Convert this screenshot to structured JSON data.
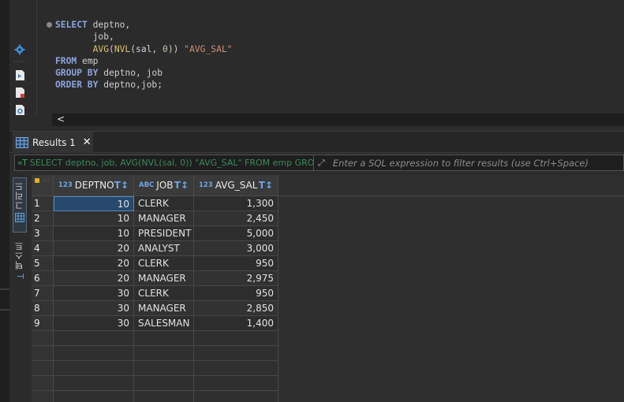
{
  "editor": {
    "lines": [
      {
        "parts": [
          [
            "kw",
            "SELECT"
          ],
          [
            "t",
            " deptno,"
          ]
        ]
      },
      {
        "parts": [
          [
            "t",
            "       job,"
          ]
        ]
      },
      {
        "parts": [
          [
            "t",
            "       "
          ],
          [
            "fn",
            "AVG"
          ],
          [
            "t",
            "("
          ],
          [
            "fn",
            "NVL"
          ],
          [
            "t",
            "(sal, "
          ],
          [
            "num",
            "0"
          ],
          [
            "t",
            ")) "
          ],
          [
            "str",
            "\"AVG_SAL\""
          ]
        ]
      },
      {
        "parts": [
          [
            "kw",
            "FROM"
          ],
          [
            "t",
            " emp"
          ]
        ]
      },
      {
        "parts": [
          [
            "kw",
            "GROUP BY"
          ],
          [
            "t",
            " deptno, job"
          ]
        ]
      },
      {
        "parts": [
          [
            "kw",
            "ORDER BY"
          ],
          [
            "t",
            " deptno,job;"
          ]
        ]
      }
    ],
    "scroll_left_glyph": "<"
  },
  "results_tab": {
    "label": "Results 1",
    "close_glyph": "✕"
  },
  "filter": {
    "sql_icon_text": "«T",
    "query_text": "SELECT deptno, job, AVG(NVL(sal, 0)) \"AVG_SAL\" FROM emp GRO",
    "placeholder": "Enter a SQL expression to filter results (use Ctrl+Space)"
  },
  "side_tabs": {
    "grid_label": "그리드",
    "text_label": "텍스트"
  },
  "grid": {
    "columns": [
      {
        "type": "123",
        "name": "DEPTNO"
      },
      {
        "type": "ABC",
        "name": "JOB"
      },
      {
        "type": "123",
        "name": "AVG_SAL"
      }
    ],
    "rows": [
      {
        "n": "1",
        "deptno": "10",
        "job": "CLERK",
        "avg_sal": "1,300"
      },
      {
        "n": "2",
        "deptno": "10",
        "job": "MANAGER",
        "avg_sal": "2,450"
      },
      {
        "n": "3",
        "deptno": "10",
        "job": "PRESIDENT",
        "avg_sal": "5,000"
      },
      {
        "n": "4",
        "deptno": "20",
        "job": "ANALYST",
        "avg_sal": "3,000"
      },
      {
        "n": "5",
        "deptno": "20",
        "job": "CLERK",
        "avg_sal": "950"
      },
      {
        "n": "6",
        "deptno": "20",
        "job": "MANAGER",
        "avg_sal": "2,975"
      },
      {
        "n": "7",
        "deptno": "30",
        "job": "CLERK",
        "avg_sal": "950"
      },
      {
        "n": "8",
        "deptno": "30",
        "job": "MANAGER",
        "avg_sal": "2,850"
      },
      {
        "n": "9",
        "deptno": "30",
        "job": "SALESMAN",
        "avg_sal": "1,400"
      }
    ],
    "selected_cell": {
      "row": 0,
      "col": "deptno"
    },
    "empty_rows": 5
  },
  "colors": {
    "keyword": "#8da4de",
    "function": "#e0c070",
    "string": "#ce9178",
    "type_badge": "#6ea4e6",
    "selection": "#27496d"
  }
}
